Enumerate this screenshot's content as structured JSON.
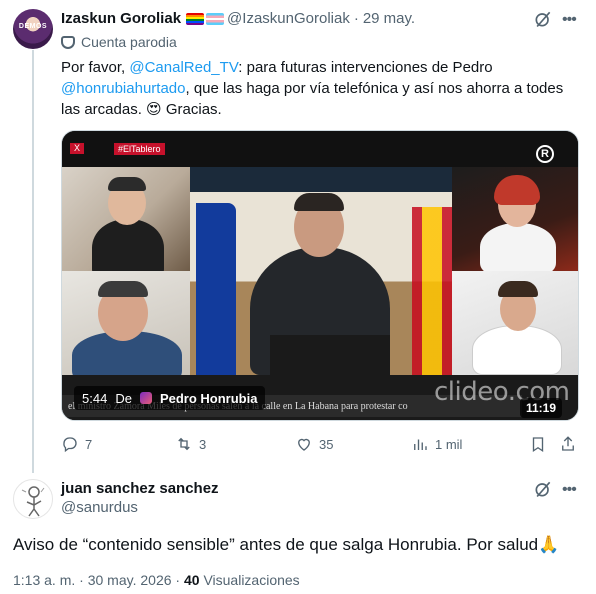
{
  "tweet": {
    "author_name": "Izaskun Goroliak",
    "handle": "@IzaskunGoroliak",
    "separator": "·",
    "date": "29 may.",
    "avatar_text": "DEMOS",
    "parody_label": "Cuenta parodia",
    "text_part1": "Por favor, ",
    "mention1": "@CanalRed_TV",
    "text_part2": ": para futuras intervenciones de Pedro ",
    "mention2": "@honrubiahurtado",
    "text_part3": ", que las haga por vía telefónica y así nos ahorra a todes las arcadas. ",
    "emoji": "😍",
    "text_part4": " Gracias.",
    "media": {
      "mark_x": "X",
      "mark_tag": "#ElTablero",
      "mark_r": "R",
      "elapsed": "5:44",
      "de_label": "De",
      "source_name": "Pedro Honrubia",
      "duration": "11:19",
      "watermark": "clideo.com",
      "ticker": "el ministro Zamora       Miles de personas salen a la calle en La Habana para protestar co"
    },
    "stats": {
      "replies": "7",
      "retweets": "3",
      "likes": "35",
      "views": "1 mil"
    }
  },
  "reply": {
    "author_name": "juan sanchez sanchez",
    "handle": "@sanurdus",
    "text": "Aviso de “contenido sensible” antes de que salga Honrubia. Por salud",
    "emoji": "🙏",
    "time": "1:13 a. m.",
    "meta_sep": "·",
    "date": "30 may. 2026",
    "meta_sep2": "·",
    "views_count": "40",
    "views_label": "Visualizaciones"
  },
  "colors": {
    "link": "#1d9bf0",
    "muted": "#536471",
    "text": "#0f1419"
  },
  "icons": [
    "grok-icon",
    "more-icon",
    "reply-icon",
    "retweet-icon",
    "like-icon",
    "views-icon",
    "bookmark-icon",
    "share-icon",
    "parody-mask-icon"
  ]
}
